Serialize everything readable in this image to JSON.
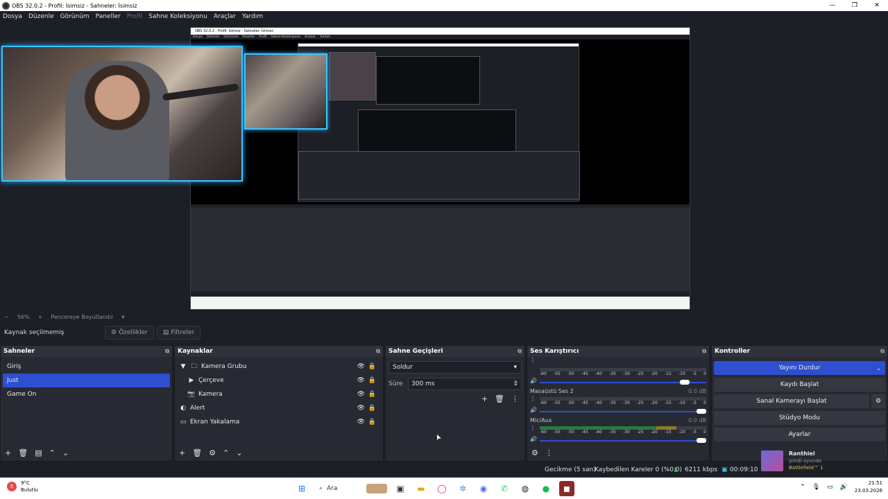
{
  "window": {
    "title": "OBS 32.0.2 - Profil: İsimsiz - Sahneler: İsimsiz"
  },
  "menu": [
    "Dosya",
    "Düzenle",
    "Görünüm",
    "Paneller",
    "Profil",
    "Sahne Koleksiyonu",
    "Araçlar",
    "Yardım"
  ],
  "menu_disabled_index": 4,
  "zoom": {
    "minus": "−",
    "value": "56%",
    "plus": "+",
    "resize": "Pencereye Boyutlandır"
  },
  "props": {
    "no_selection": "Kaynak seçilmemiş",
    "properties": "Özellikler",
    "filters": "Filtreler"
  },
  "scenes": {
    "title": "Sahneler",
    "items": [
      "Giriş",
      "Just",
      "Game On"
    ],
    "selected_index": 1
  },
  "sources": {
    "title": "Kaynaklar",
    "items": [
      {
        "label": "Kamera Grubu",
        "icon": "folder-icon",
        "level": 0,
        "expand": "▼"
      },
      {
        "label": "Çerçeve",
        "icon": "play-icon",
        "level": 1,
        "expand": ""
      },
      {
        "label": "Kamera",
        "icon": "camera-icon",
        "level": 1,
        "expand": ""
      },
      {
        "label": "Alert",
        "icon": "globe-icon",
        "level": 0,
        "expand": ""
      },
      {
        "label": "Ekran Yakalama",
        "icon": "monitor-icon",
        "level": 0,
        "expand": ""
      }
    ]
  },
  "transitions": {
    "title": "Sahne Geçişleri",
    "selected": "Soldur",
    "duration_label": "Süre",
    "duration_value": "300 ms"
  },
  "mixer": {
    "title": "Ses Karıştırıcı",
    "ticks": [
      "-60",
      "-55",
      "-50",
      "-45",
      "-40",
      "-35",
      "-30",
      "-25",
      "-20",
      "-15",
      "-10",
      "-5",
      "0"
    ],
    "channels": [
      {
        "name": "",
        "db": "",
        "level": 0.0,
        "volume": 0.9
      },
      {
        "name": "Masaüstü Ses 2",
        "db": "0.0 dB",
        "level": 0.0,
        "volume": 1.0
      },
      {
        "name": "Mic/Aux",
        "db": "0.0 dB",
        "level": 0.82,
        "volume": 1.0
      }
    ]
  },
  "controls": {
    "title": "Kontroller",
    "stop_stream": "Yayını Durdur",
    "start_record": "Kaydı Başlat",
    "virtual_cam": "Sanal Kamerayı Başlat",
    "studio_mode": "Stüdyo Modu",
    "settings": "Ayarlar"
  },
  "status": {
    "delay": "Gecikme (5 san)",
    "dropped": "Kaybedilen Kareler 0 (%0.0)",
    "bitrate": "6211 kbps",
    "time": "00:09:10"
  },
  "streamer": {
    "name": "Ranthiel",
    "activity": "şimdi oyunda",
    "game": "Battlefield™ 1"
  },
  "taskbar": {
    "weather_temp": "9°C",
    "weather_desc": "Bulutlu",
    "weather_badge": "5",
    "search": "Ara",
    "time": "21:51",
    "date": "23.03.2026"
  },
  "nested": {
    "title": "OBS 32.0.2 - Profil: İsimsiz - Sahneler: İsimsiz",
    "menu": [
      "Dosya",
      "Düzenle",
      "Görünüm",
      "Paneller",
      "Profil",
      "Sahne Koleksiyonu",
      "Araçlar",
      "Yardım"
    ]
  },
  "colors": {
    "accent": "#2f4fd1",
    "background": "#1d1f26",
    "dock": "#272a33",
    "glow": "#39c6ff"
  }
}
